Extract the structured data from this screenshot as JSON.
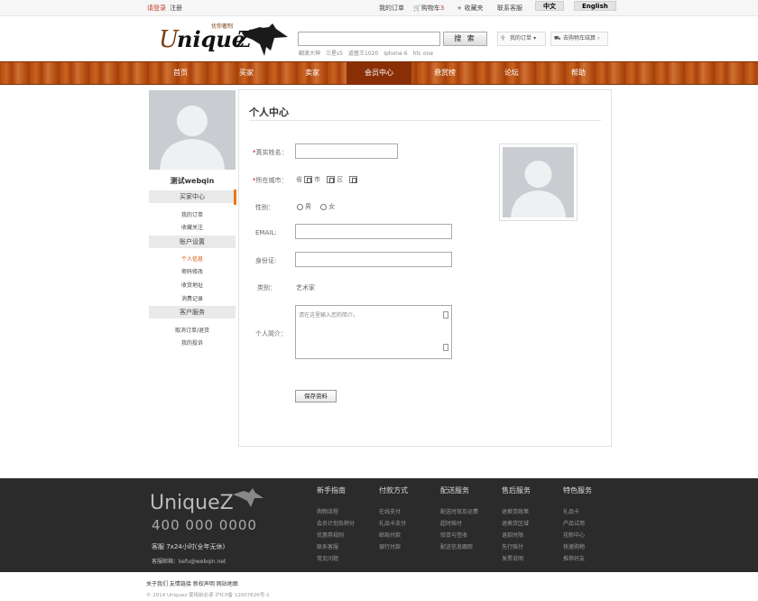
{
  "topbar": {
    "login": "请登录",
    "register": "注册",
    "my_orders": "我的订单",
    "cart_label": "购物车",
    "cart_count": "3",
    "favorites": "收藏夹",
    "contact": "联系客服",
    "lang_cn": "中文",
    "lang_en": "English"
  },
  "header": {
    "logo_text": "Uniquez",
    "logo_tagline": "优你奢制",
    "search_button": "搜 索",
    "hot_words": [
      "翻滚大神",
      "三星s5",
      "道基王1020",
      "Iphone 6",
      "htc one"
    ],
    "my_orders": "我的订单",
    "cart_checkout": "去购物车结算"
  },
  "nav": {
    "items": [
      "首页",
      "买家",
      "卖家",
      "会员中心",
      "悬赏榜",
      "论坛",
      "帮助"
    ],
    "active": "会员中心"
  },
  "sidebar": {
    "username": "测试webqin",
    "sections": [
      {
        "title": "买家中心",
        "links": [
          "我的订单",
          "收藏关注"
        ]
      },
      {
        "title": "账户设置",
        "links": [
          "个人信息",
          "密码修改",
          "收货地址",
          "消费记录"
        ]
      },
      {
        "title": "客户服务",
        "links": [
          "取消订单/退货",
          "我的投诉"
        ]
      }
    ],
    "active_link": "个人信息"
  },
  "main": {
    "title": "个人中心",
    "real_name_label": "真实姓名：",
    "city_label": "所在城市：",
    "province": "省",
    "city": "市",
    "district": "区",
    "gender_label": "性别：",
    "male": "男",
    "female": "女",
    "email_label": "EMAIL:",
    "id_label": "身份证:",
    "category_label": "类别：",
    "category_value": "艺术家",
    "intro_label": "个人简介：",
    "intro_placeholder": "请在这里输入您的简介。",
    "save_button": "保存资料",
    "required_mark": "*"
  },
  "footer": {
    "logo_text": "UniqueZ",
    "phone": "400 000 0000",
    "hours": "客服 7x24小时(全年无休)",
    "email": "客服邮箱：kefu@webqin.net",
    "columns": [
      {
        "title": "新手指南",
        "links": [
          "购物流程",
          "会员计划及积分",
          "优惠券规则",
          "联系客服",
          "常见问题"
        ]
      },
      {
        "title": "付款方式",
        "links": [
          "在线支付",
          "礼品卡支付",
          "邮局付款",
          "银行付款"
        ]
      },
      {
        "title": "配送服务",
        "links": [
          "配送时效及运费",
          "超时赔付",
          "验货与签收",
          "配送信息跟踪"
        ]
      },
      {
        "title": "售后服务",
        "links": [
          "退换货政策",
          "退换货区域",
          "退款时限",
          "先行赔付",
          "发票说明"
        ]
      },
      {
        "title": "特色服务",
        "links": [
          "礼品卡",
          "产品试用",
          "花粉中心",
          "快速购物",
          "推荐好友"
        ]
      }
    ],
    "bottom_links": "关于我们 友情链接 新权声明 网站地图",
    "copyright": "© 2014 Uniquez 使用前必读 沪ICP备 12007626号-1"
  }
}
